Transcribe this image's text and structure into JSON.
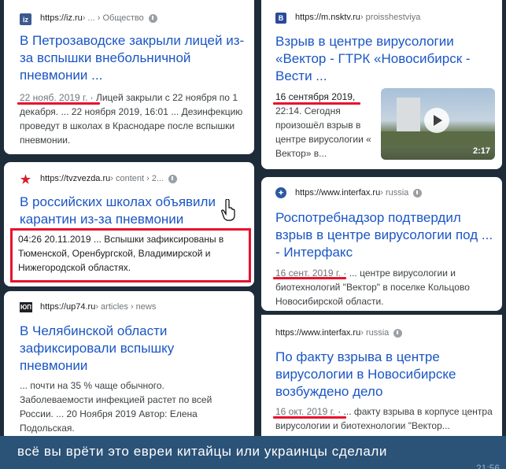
{
  "left": {
    "card1": {
      "favicon": "iz",
      "host": "https://iz.ru",
      "path": " › ... › Общество",
      "title": "В Петрозаводске закрыли лицей из-за вспышки внебольничной пневмонии ...",
      "date": "22 нояб. 2019 г.",
      "snippet": " · Лицей закрыли с 22 ноября по 1 декабря. ... 22 ноября 2019, 16:01 ... Дезинфекцию проведут в школах в Краснодаре после вспышки пневмонии."
    },
    "card2": {
      "favicon": "★",
      "host": "https://tvzvezda.ru",
      "path": " › content › 2...",
      "title": "В российских школах объявили карантин из-за пневмонии",
      "snippet": "04:26 20.11.2019 ... Вспышки зафиксированы в Тюменской, Оренбургской, Владимирской и Нижегородской областях."
    },
    "card3": {
      "favicon": "ЮП",
      "host": "https://up74.ru",
      "path": " › articles › news",
      "title": "В Челябинской области зафиксировали вспышку пневмонии",
      "snippet": "... почти на 35 % чаще обычного. Заболеваемости инфекцией растет по всей России. ... 20 Ноября 2019 Автор: Елена Подольская."
    }
  },
  "right": {
    "card1": {
      "favicon": "B",
      "host": "https://m.nsktv.ru",
      "path": " › proisshestviya",
      "title": "Взрыв в центре вирусологии «Вектор - ГТРК «Новосибирск - Вести ...",
      "date": "16 сентября 2019,",
      "snippet": "22:14. Сегодня произошёл взрыв в центре вирусологии « Вектор» в...",
      "video_duration": "2:17"
    },
    "card2": {
      "favicon": "✦",
      "host": "https://www.interfax.ru",
      "path": " › russia",
      "title": "Роспотребнадзор подтвердил взрыв в центре вирусологии под ... - Интерфакс",
      "date": "16 сент. 2019 г.",
      "snippet": " · ... центре вирусологии и биотехнологий \"Вектор\" в поселке Кольцово Новосибирской области."
    },
    "card3": {
      "host": "https://www.interfax.ru",
      "path": " › russia",
      "title": "По факту взрыва в центре вирусологии в Новосибирске возбуждено дело",
      "date": "16 окт. 2019 г.",
      "snippet": " · ... факту взрыва в корпусе центра вирусологии и биотехнологии \"Вектор..."
    }
  },
  "caption": {
    "text": "всё вы врёти это евреи китайцы или украинцы сделали",
    "time": "21:56"
  },
  "colors": {
    "link": "#1a56c5",
    "highlight": "#e8112d",
    "background": "#1e2c3a",
    "caption_bar": "#2b5277"
  }
}
